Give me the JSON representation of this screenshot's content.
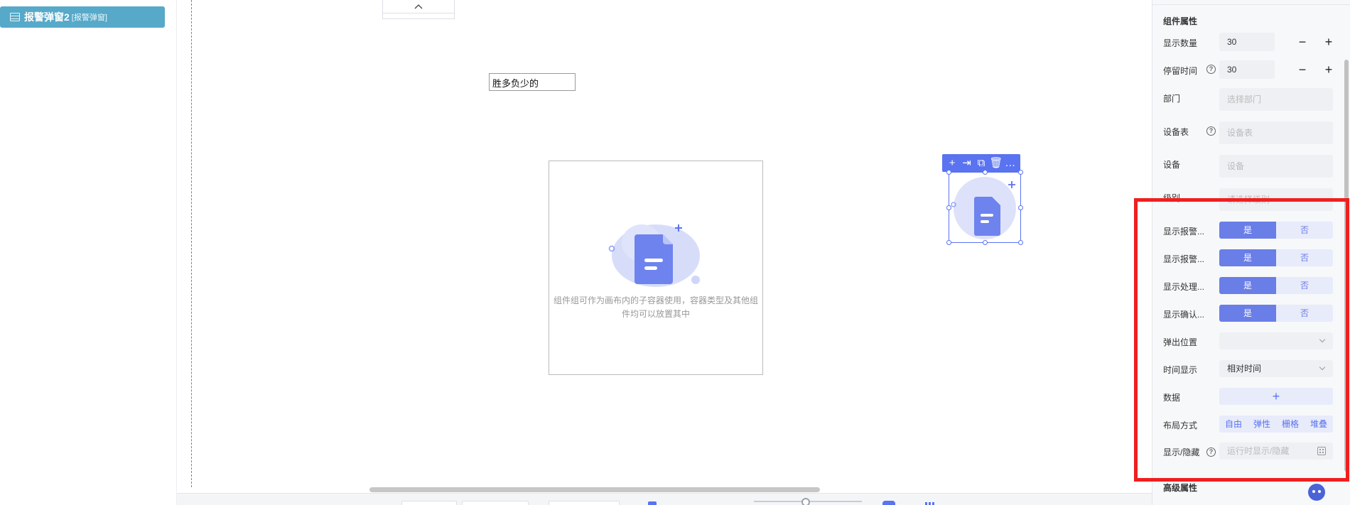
{
  "tree": {
    "item_label": "报警弹窗2",
    "item_type": "[报警弹窗]"
  },
  "canvas": {
    "collapse_icon": "chevron-up-icon",
    "text_box_value": "胜多负少的",
    "group_placeholder": "组件组可作为画布内的子容器使用，容器类型及其他组件均可以放置其中",
    "toolbar_icons": [
      "plus-icon",
      "exit-icon",
      "copy-icon",
      "trash-icon",
      "more-icon"
    ],
    "toolbar_glyphs": [
      "+",
      "⇥",
      "⧉",
      "🗑",
      "…"
    ]
  },
  "properties": {
    "section_title": "组件属性",
    "display_count": {
      "label": "显示数量",
      "value": "30"
    },
    "stay_time": {
      "label": "停留时间",
      "value": "30"
    },
    "department": {
      "label": "部门",
      "placeholder": "选择部门"
    },
    "device_table": {
      "label": "设备表",
      "placeholder": "设备表"
    },
    "device": {
      "label": "设备",
      "placeholder": "设备"
    },
    "level": {
      "label": "级别",
      "placeholder": "请选择级别"
    },
    "toggles": [
      {
        "label": "显示报警...",
        "on": "是",
        "off": "否"
      },
      {
        "label": "显示报警...",
        "on": "是",
        "off": "否"
      },
      {
        "label": "显示处理...",
        "on": "是",
        "off": "否"
      },
      {
        "label": "显示确认...",
        "on": "是",
        "off": "否"
      }
    ],
    "popup_position": {
      "label": "弹出位置",
      "value": ""
    },
    "time_display": {
      "label": "时间显示",
      "value": "相对时间"
    },
    "data": {
      "label": "数据",
      "add": "+"
    },
    "layout": {
      "label": "布局方式",
      "options": [
        "自由",
        "弹性",
        "栅格",
        "堆叠"
      ]
    },
    "visibility": {
      "label": "显示/隐藏",
      "placeholder": "运行时显示/隐藏"
    },
    "advanced_title": "高级属性",
    "minus": "−",
    "plus": "+",
    "help": "?"
  },
  "colors": {
    "accent": "#5a73f0",
    "highlight": "#ef1f1f",
    "tree_item": "#56a9c8"
  }
}
